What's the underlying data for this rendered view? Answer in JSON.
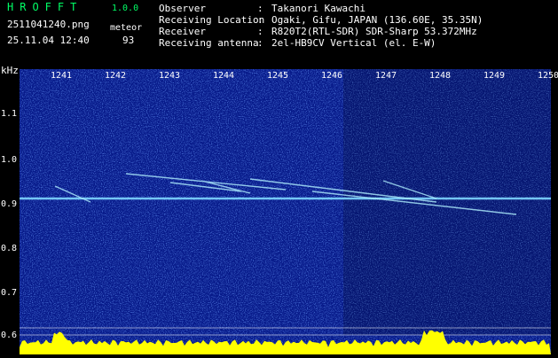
{
  "header": {
    "app_title": "HROFFT",
    "version": "1.0.0",
    "file_name": "2511041240.png",
    "mode_label": "meteor",
    "timestamp": "25.11.04 12:40",
    "meteor_count": "93",
    "info": [
      {
        "label": "Observer",
        "value": "Takanori Kawachi"
      },
      {
        "label": "Receiving Location",
        "value": "Ogaki, Gifu, JAPAN (136.60E, 35.35N)"
      },
      {
        "label": "Receiver",
        "value": "R820T2(RTL-SDR) SDR-Sharp 53.372MHz"
      },
      {
        "label": "Receiving antenna",
        "value": "2el-HB9CV Vertical (el. E-W)"
      }
    ]
  },
  "spectrogram": {
    "y_unit": "kHz",
    "y_ticks": [
      "1.1",
      "1.0",
      "0.9",
      "0.8",
      "0.7",
      "0.6"
    ],
    "x_ticks": [
      "1241",
      "1242",
      "1243",
      "1244",
      "1245",
      "1246",
      "1247",
      "1248",
      "1249",
      "1250"
    ],
    "colors": {
      "background": "#071a8a",
      "carrier": "#7fd7ff",
      "echo": "#b0f0ff",
      "level": "#ffff00"
    }
  }
}
